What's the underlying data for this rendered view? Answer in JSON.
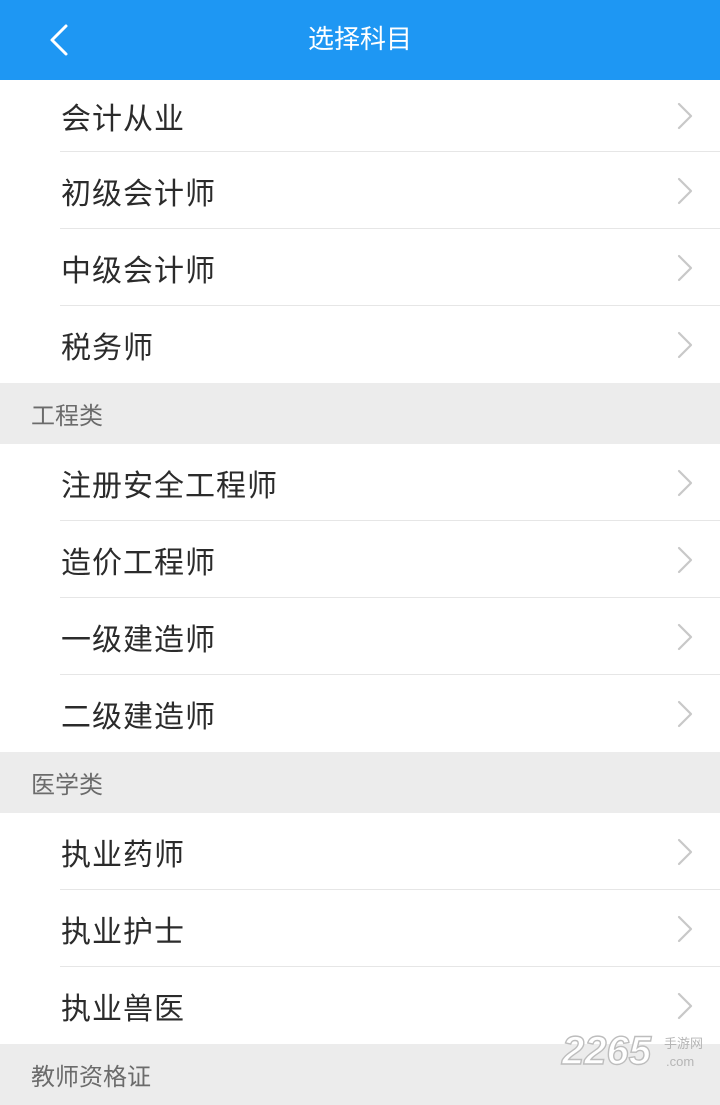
{
  "header": {
    "title": "选择科目",
    "back_icon": "chevron-left-icon",
    "background_color": "#1e97f3"
  },
  "sections": [
    {
      "label": "",
      "items": [
        {
          "label": "会计从业"
        },
        {
          "label": "初级会计师"
        },
        {
          "label": "中级会计师"
        },
        {
          "label": "税务师"
        }
      ]
    },
    {
      "label": "工程类",
      "items": [
        {
          "label": "注册安全工程师"
        },
        {
          "label": "造价工程师"
        },
        {
          "label": "一级建造师"
        },
        {
          "label": "二级建造师"
        }
      ]
    },
    {
      "label": "医学类",
      "items": [
        {
          "label": "执业药师"
        },
        {
          "label": "执业护士"
        },
        {
          "label": "执业兽医"
        }
      ]
    },
    {
      "label": "教师资格证",
      "items": []
    }
  ],
  "watermark": {
    "number": "2265",
    "site": "手游网",
    "domain": ".com"
  },
  "colors": {
    "item_text": "#2b2b2b",
    "section_text": "#6b6b6b",
    "section_bg": "#ececec",
    "divider": "#e6e6e6",
    "chevron": "#c8c8c8"
  }
}
